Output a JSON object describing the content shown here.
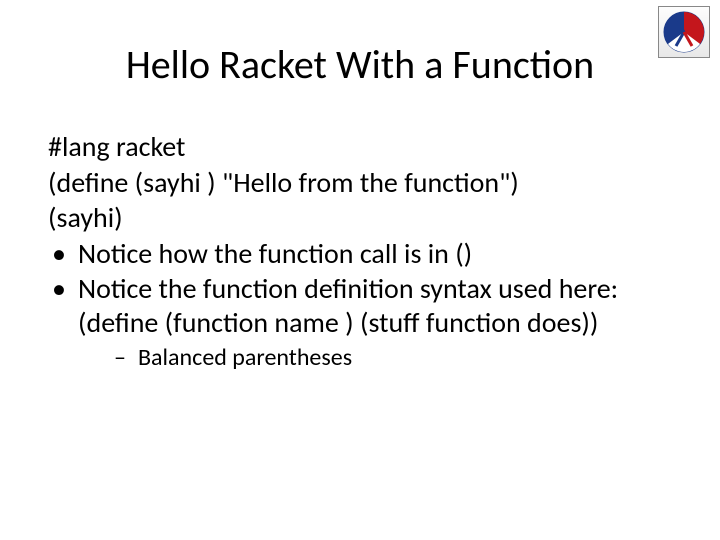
{
  "title": "Hello Racket With a Function",
  "code": {
    "line1": "#lang racket",
    "line2": "(define (sayhi ) \"Hello from the function\")",
    "line3": "(sayhi)"
  },
  "bullets": [
    "Notice how the function call is in ()",
    "Notice the function definition syntax used here: (define (function name ) (stuff function does))"
  ],
  "subbullets": [
    "Balanced parentheses"
  ],
  "logo_name": "lambda-logo"
}
